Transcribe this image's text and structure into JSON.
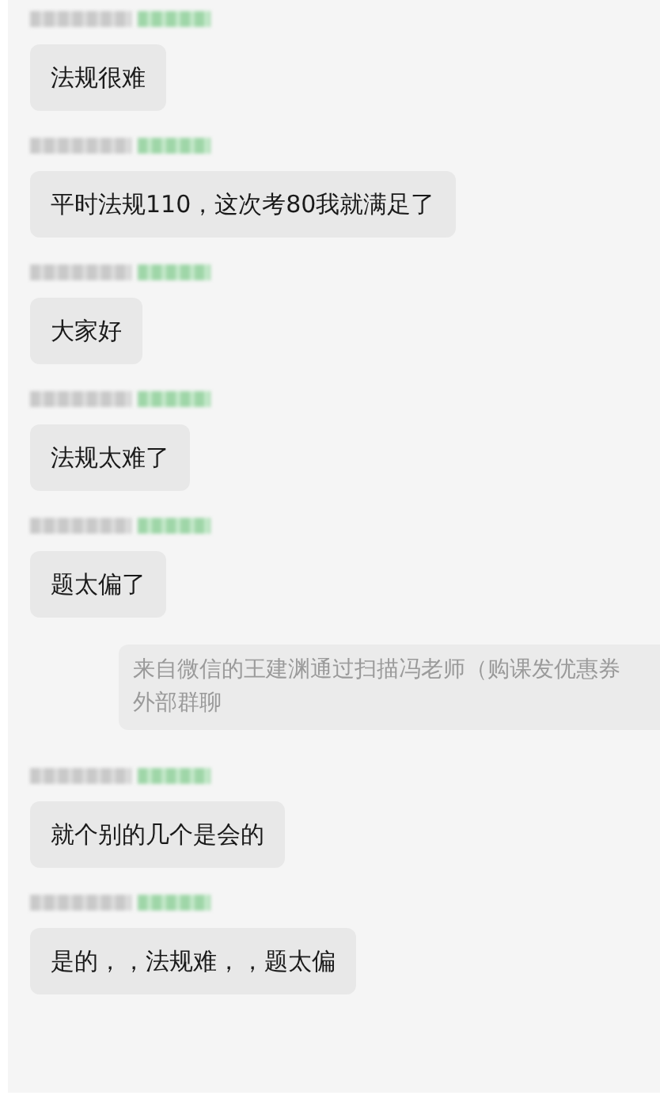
{
  "messages": [
    {
      "kind": "chat",
      "sender_blurred": true,
      "text": "法规很难"
    },
    {
      "kind": "chat",
      "sender_blurred": true,
      "text": "平时法规110，这次考80我就满足了"
    },
    {
      "kind": "chat",
      "sender_blurred": true,
      "text": "大家好"
    },
    {
      "kind": "chat",
      "sender_blurred": true,
      "text": "法规太难了"
    },
    {
      "kind": "chat",
      "sender_blurred": true,
      "text": "题太偏了"
    },
    {
      "kind": "notice",
      "lines": [
        "来自微信的王建渊通过扫描冯老师（购课发优惠券",
        "外部群聊"
      ]
    },
    {
      "kind": "chat",
      "sender_blurred": true,
      "text": "就个别的几个是会的"
    },
    {
      "kind": "chat",
      "sender_blurred": true,
      "text": "是的，，法规难，，题太偏"
    }
  ]
}
